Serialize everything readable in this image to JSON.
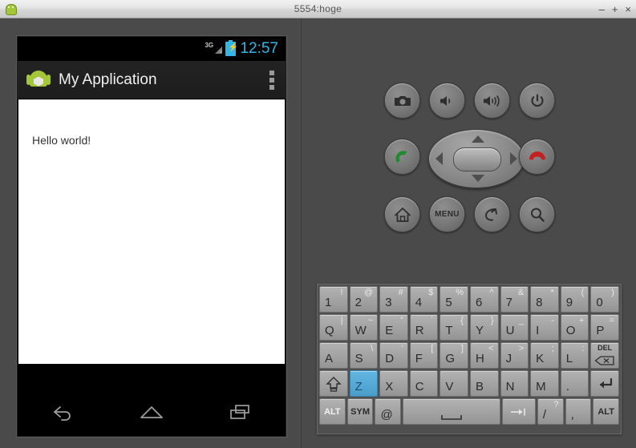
{
  "window": {
    "title": "5554:hoge",
    "icon": "android-logo-icon",
    "minimize_label": "–",
    "maximize_label": "+",
    "close_label": "×"
  },
  "device": {
    "status_bar": {
      "network_label": "3G",
      "network_state": "no-service",
      "battery_state": "charging",
      "clock": "12:57",
      "clock_color": "#33b5e5"
    },
    "action_bar": {
      "app_icon": "android-robot-icon",
      "title": "My Application",
      "overflow_label": "overflow-menu"
    },
    "content": {
      "text": "Hello world!"
    },
    "nav_bar": {
      "items": [
        {
          "name": "back",
          "icon": "back-arrow-icon"
        },
        {
          "name": "home",
          "icon": "home-icon"
        },
        {
          "name": "recents",
          "icon": "recents-icon"
        }
      ]
    }
  },
  "controls": {
    "row1": [
      {
        "name": "camera",
        "icon": "camera-icon",
        "label": ""
      },
      {
        "name": "volume-down",
        "icon": "volume-down-icon",
        "label": ""
      },
      {
        "name": "volume-up",
        "icon": "volume-up-icon",
        "label": ""
      },
      {
        "name": "power",
        "icon": "power-icon",
        "label": ""
      }
    ],
    "row2": {
      "call": {
        "name": "call",
        "icon": "phone-call-icon",
        "color": "#1f8a2e"
      },
      "dpad": {
        "name": "dpad",
        "up": "dpad-up-icon",
        "down": "dpad-down-icon",
        "left": "dpad-left-icon",
        "right": "dpad-right-icon",
        "center": "dpad-center-button"
      },
      "endcall": {
        "name": "end-call",
        "icon": "phone-hangup-icon",
        "color": "#c32020"
      }
    },
    "row3": [
      {
        "name": "home",
        "icon": "house-icon",
        "label": ""
      },
      {
        "name": "menu",
        "icon": "",
        "label": "MENU"
      },
      {
        "name": "back",
        "icon": "back-curve-icon",
        "label": ""
      },
      {
        "name": "search",
        "icon": "magnifier-icon",
        "label": ""
      }
    ]
  },
  "keyboard": {
    "rows": [
      {
        "name": "number-row",
        "keys": [
          {
            "main": "1",
            "sup": "!"
          },
          {
            "main": "2",
            "sup": "@"
          },
          {
            "main": "3",
            "sup": "#"
          },
          {
            "main": "4",
            "sup": "$"
          },
          {
            "main": "5",
            "sup": "%"
          },
          {
            "main": "6",
            "sup": "^"
          },
          {
            "main": "7",
            "sup": "&"
          },
          {
            "main": "8",
            "sup": "*"
          },
          {
            "main": "9",
            "sup": "("
          },
          {
            "main": "0",
            "sup": ")"
          }
        ]
      },
      {
        "name": "qwerty-row",
        "keys": [
          {
            "main": "Q",
            "sup": "|"
          },
          {
            "main": "W",
            "sup": "~"
          },
          {
            "main": "E",
            "sup": "”"
          },
          {
            "main": "R",
            "sup": "`"
          },
          {
            "main": "T",
            "sup": "{"
          },
          {
            "main": "Y",
            "sup": "}"
          },
          {
            "main": "U",
            "sup": "_"
          },
          {
            "main": "I",
            "sup": "-"
          },
          {
            "main": "O",
            "sup": "+"
          },
          {
            "main": "P",
            "sup": "="
          }
        ]
      },
      {
        "name": "home-row",
        "keys": [
          {
            "main": "A",
            "sup": ""
          },
          {
            "main": "S",
            "sup": "\\"
          },
          {
            "main": "D",
            "sup": "’"
          },
          {
            "main": "F",
            "sup": "["
          },
          {
            "main": "G",
            "sup": "]"
          },
          {
            "main": "H",
            "sup": "<"
          },
          {
            "main": "J",
            "sup": ">"
          },
          {
            "main": "K",
            "sup": ";"
          },
          {
            "main": "L",
            "sup": ":"
          },
          {
            "main": "DEL",
            "sup": "",
            "icon": "backspace-icon",
            "type": "del"
          }
        ]
      },
      {
        "name": "bottom-letter-row",
        "keys": [
          {
            "main": "",
            "sup": "",
            "icon": "shift-icon",
            "type": "shift"
          },
          {
            "main": "Z",
            "sup": "",
            "state": "active"
          },
          {
            "main": "X",
            "sup": ""
          },
          {
            "main": "C",
            "sup": ""
          },
          {
            "main": "V",
            "sup": ""
          },
          {
            "main": "B",
            "sup": ""
          },
          {
            "main": "N",
            "sup": ""
          },
          {
            "main": "M",
            "sup": ""
          },
          {
            "main": ".",
            "sup": ""
          },
          {
            "main": "",
            "sup": "",
            "icon": "enter-icon",
            "type": "enter"
          }
        ]
      },
      {
        "name": "modifier-row",
        "keys": [
          {
            "main": "ALT",
            "sup": "",
            "type": "label-white"
          },
          {
            "main": "SYM",
            "sup": "",
            "type": "label-dark"
          },
          {
            "main": "@",
            "sup": ""
          },
          {
            "main": "",
            "sup": "",
            "icon": "space-icon",
            "type": "space"
          },
          {
            "main": "",
            "sup": "",
            "icon": "tab-icon",
            "type": "tab"
          },
          {
            "main": "/",
            "sup": "?"
          },
          {
            "main": ",",
            "sup": ""
          },
          {
            "main": "ALT",
            "sup": "",
            "type": "label-dark"
          }
        ]
      }
    ]
  }
}
